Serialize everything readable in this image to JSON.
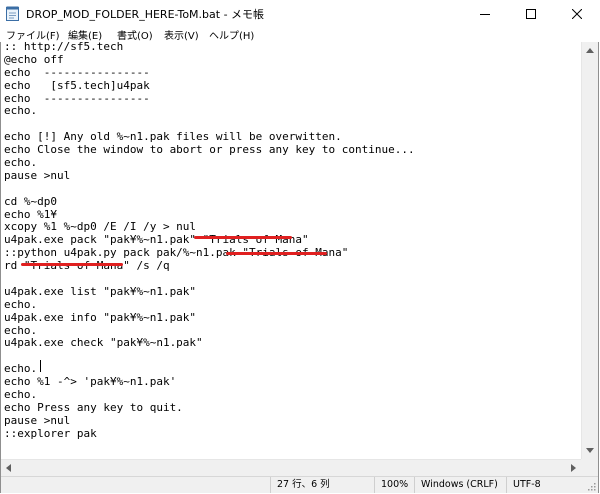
{
  "window": {
    "title": "DROP_MOD_FOLDER_HERE-ToM.bat - メモ帳",
    "minimize_icon": "minimize-icon",
    "maximize_icon": "maximize-icon",
    "close_icon": "close-icon"
  },
  "menu": {
    "file": "ファイル(F)",
    "edit": "編集(E)",
    "format": "書式(O)",
    "view": "表示(V)",
    "help": "ヘルプ(H)"
  },
  "editor": {
    "lines": [
      ":: http://sf5.tech",
      "@echo off",
      "echo  ----------------",
      "echo   [sf5.tech]u4pak",
      "echo  ----------------",
      "echo.",
      "",
      "echo [!] Any old %~n1.pak files will be overwitten.",
      "echo Close the window to abort or press any key to continue...",
      "echo.",
      "pause >nul",
      "",
      "cd %~dp0",
      "echo %1¥",
      "xcopy %1 %~dp0 /E /I /y > nul",
      "u4pak.exe pack \"pak¥%~n1.pak\" \"Trials of Mana\"",
      "::python u4pak.py pack pak/%~n1.pak \"Trials of Mana\"",
      "rd \"Trials of Mana\" /s /q",
      "",
      "u4pak.exe list \"pak¥%~n1.pak\"",
      "echo.",
      "u4pak.exe info \"pak¥%~n1.pak\"",
      "echo.",
      "u4pak.exe check \"pak¥%~n1.pak\"",
      "",
      "echo.",
      "echo %1 -^> 'pak¥%~n1.pak'",
      "echo.",
      "echo Press any key to quit.",
      "pause >nul",
      "::explorer pak"
    ]
  },
  "statusbar": {
    "position": "27 行、6 列",
    "zoom": "100%",
    "line_ending": "Windows (CRLF)",
    "encoding": "UTF-8"
  },
  "colors": {
    "annotation_underline": "#e02020"
  }
}
